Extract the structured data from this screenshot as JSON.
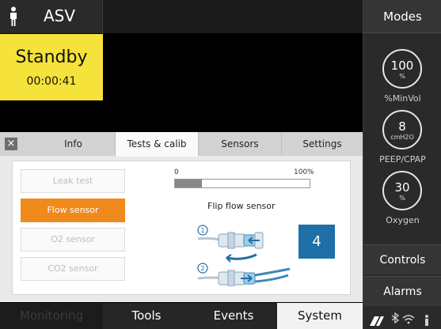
{
  "header": {
    "mode": "ASV"
  },
  "status": {
    "title": "Standby",
    "timer": "00:00:41"
  },
  "dialog": {
    "close_label": "×",
    "tabs": [
      {
        "label": "Info"
      },
      {
        "label": "Tests & calib"
      },
      {
        "label": "Sensors"
      },
      {
        "label": "Settings"
      }
    ],
    "active_tab": "Tests & calib",
    "buttons": [
      {
        "label": "Leak test",
        "state": "disabled"
      },
      {
        "label": "Flow sensor",
        "state": "active"
      },
      {
        "label": "O2 sensor",
        "state": "disabled"
      },
      {
        "label": "CO2 sensor",
        "state": "disabled"
      }
    ],
    "progress": {
      "min_label": "0",
      "max_label": "100%",
      "value_fraction": 0.2
    },
    "instruction": "Flip flow sensor",
    "step_labels": [
      "1",
      "2"
    ],
    "step_number": "4"
  },
  "bottom_nav": {
    "monitoring": "Monitoring",
    "tools": "Tools",
    "events": "Events",
    "system": "System",
    "active": "System"
  },
  "right_panel": {
    "modes": "Modes",
    "params": [
      {
        "value": "100",
        "unit": "%",
        "label": "%MinVol"
      },
      {
        "value": "8",
        "unit": "cmH2O",
        "label": "PEEP/CPAP"
      },
      {
        "value": "30",
        "unit": "%",
        "label": "Oxygen"
      }
    ],
    "controls": "Controls",
    "alarms": "Alarms",
    "status_icons": [
      "battery-icon",
      "bluetooth-icon",
      "wifi-icon"
    ]
  },
  "colors": {
    "standby_yellow": "#f5e23b",
    "active_orange": "#f08a1c",
    "step_blue": "#1f6fa8"
  }
}
